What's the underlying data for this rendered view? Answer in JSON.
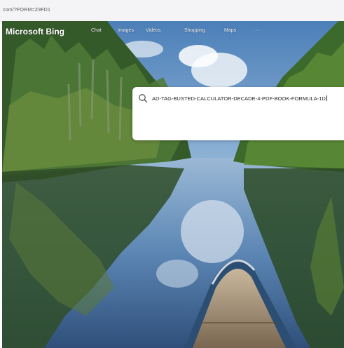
{
  "browser": {
    "url_fragment": "com/?FORM=Z9FD1"
  },
  "header": {
    "logo": "Microsoft Bing",
    "nav": {
      "chat": "Chat",
      "images": "Images",
      "videos": "Videos",
      "shopping": "Shopping",
      "maps": "Maps",
      "more": "···"
    }
  },
  "search": {
    "query": "AD-TAG-BUSTED-CALCULATOR-DECADE-4-PDF-BOOK-FORMULA-1D"
  },
  "icons": {
    "search": "search-icon"
  },
  "colors": {
    "accent": "#ffffff",
    "text": "#222222"
  }
}
